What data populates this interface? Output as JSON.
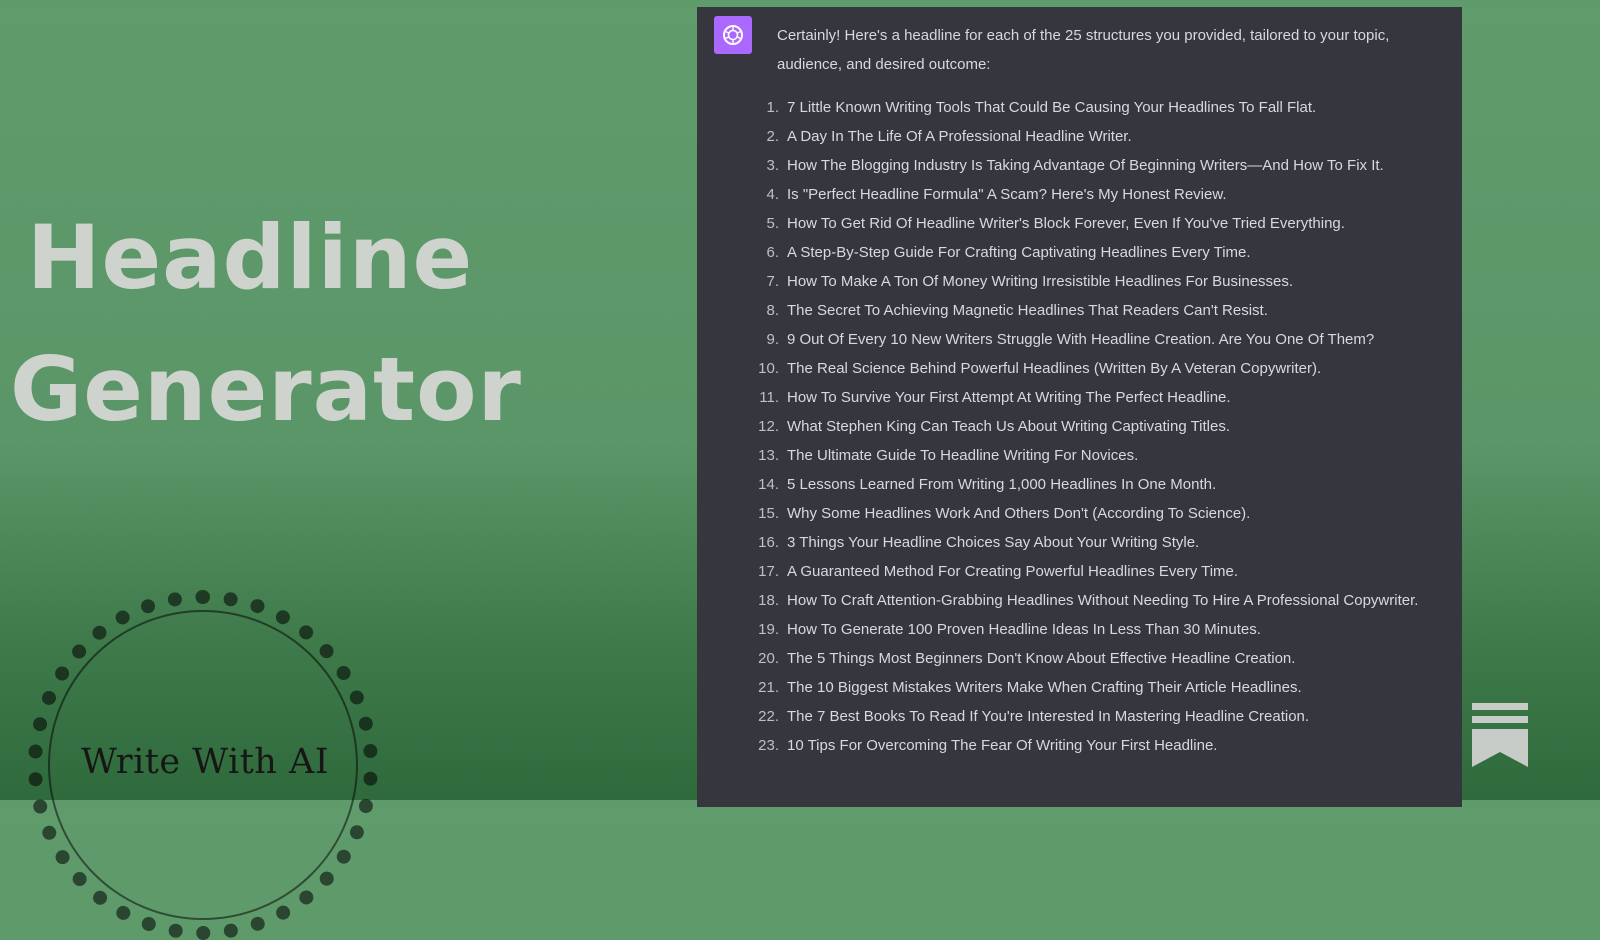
{
  "hero": {
    "line1": "Headline",
    "line2": "Generator"
  },
  "brand": {
    "name": "Write With AI"
  },
  "chat": {
    "avatar_icon": "openai-logo-icon",
    "avatar_color": "#ab68ff",
    "intro": "Certainly! Here's a headline for each of the 25 structures you provided, tailored to your topic, audience, and desired outcome:",
    "items": [
      {
        "num": "1.",
        "text": "7 Little Known Writing Tools That Could Be Causing Your Headlines To Fall Flat."
      },
      {
        "num": "2.",
        "text": "A Day In The Life Of A Professional Headline Writer."
      },
      {
        "num": "3.",
        "text": "How The Blogging Industry Is Taking Advantage Of Beginning Writers—And How To Fix It."
      },
      {
        "num": "4.",
        "text": "Is \"Perfect Headline Formula\" A Scam? Here's My Honest Review."
      },
      {
        "num": "5.",
        "text": "How To Get Rid Of Headline Writer's Block Forever, Even If You've Tried Everything."
      },
      {
        "num": "6.",
        "text": "A Step-By-Step Guide For Crafting Captivating Headlines Every Time."
      },
      {
        "num": "7.",
        "text": "How To Make A Ton Of Money Writing Irresistible Headlines For Businesses."
      },
      {
        "num": "8.",
        "text": "The Secret To Achieving Magnetic Headlines That Readers Can't Resist."
      },
      {
        "num": "9.",
        "text": "9 Out Of Every 10 New Writers Struggle With Headline Creation. Are You One Of Them?"
      },
      {
        "num": "10.",
        "text": "The Real Science Behind Powerful Headlines (Written By A Veteran Copywriter)."
      },
      {
        "num": "11.",
        "text": "How To Survive Your First Attempt At Writing The Perfect Headline."
      },
      {
        "num": "12.",
        "text": "What Stephen King Can Teach Us About Writing Captivating Titles."
      },
      {
        "num": "13.",
        "text": "The Ultimate Guide To Headline Writing For Novices."
      },
      {
        "num": "14.",
        "text": "5 Lessons Learned From Writing 1,000 Headlines In One Month."
      },
      {
        "num": "15.",
        "text": "Why Some Headlines Work And Others Don't (According To Science)."
      },
      {
        "num": "16.",
        "text": "3 Things Your Headline Choices Say About Your Writing Style."
      },
      {
        "num": "17.",
        "text": "A Guaranteed Method For Creating Powerful Headlines Every Time."
      },
      {
        "num": "18.",
        "text": "How To Craft Attention-Grabbing Headlines Without Needing To Hire A Professional Copywriter."
      },
      {
        "num": "19.",
        "text": "How To Generate 100 Proven Headline Ideas In Less Than 30 Minutes."
      },
      {
        "num": "20.",
        "text": "The 5 Things Most Beginners Don't Know About Effective Headline Creation."
      },
      {
        "num": "21.",
        "text": "The 10 Biggest Mistakes Writers Make When Crafting Their Article Headlines."
      },
      {
        "num": "22.",
        "text": "The 7 Best Books To Read If You're Interested In Mastering Headline Creation."
      },
      {
        "num": "23.",
        "text": "10 Tips For Overcoming The Fear Of Writing Your First Headline."
      }
    ]
  },
  "corner_icon": "bookmark-icon"
}
